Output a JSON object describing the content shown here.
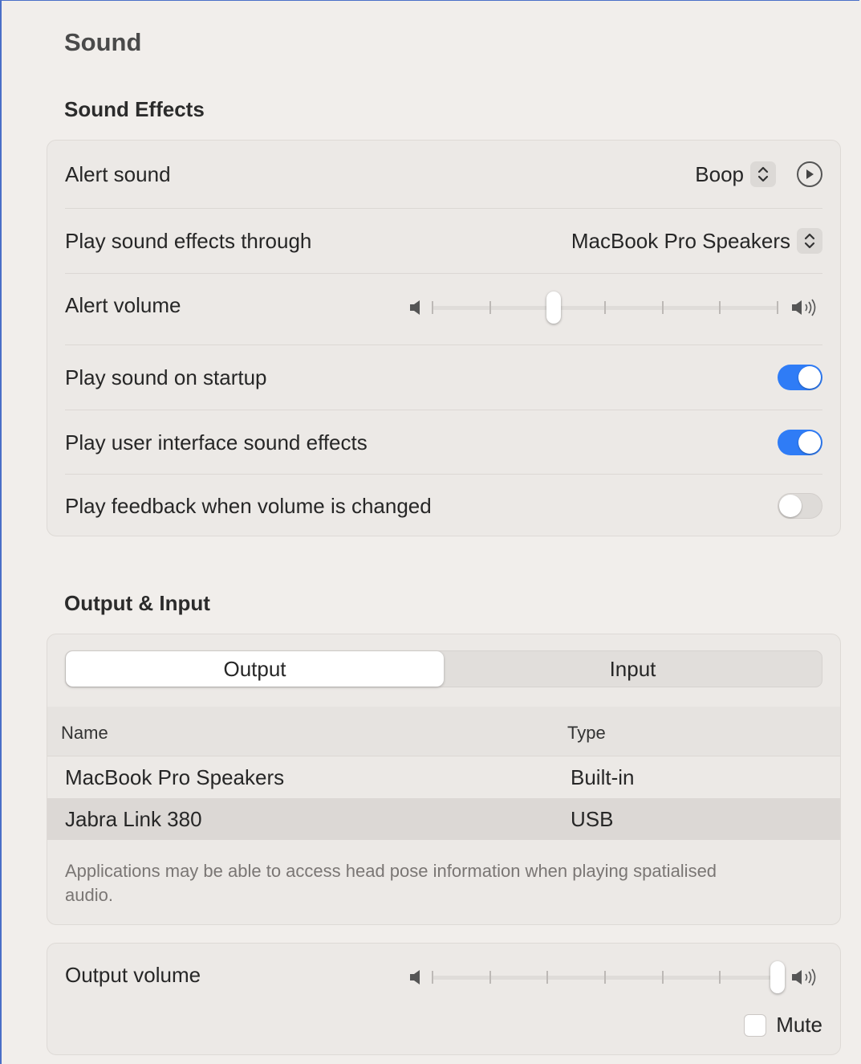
{
  "page": {
    "title": "Sound"
  },
  "sound_effects": {
    "title": "Sound Effects",
    "alert_sound": {
      "label": "Alert sound",
      "value": "Boop"
    },
    "play_through": {
      "label": "Play sound effects through",
      "value": "MacBook Pro Speakers"
    },
    "alert_volume": {
      "label": "Alert volume",
      "level": 0.35
    },
    "startup": {
      "label": "Play sound on startup",
      "on": true
    },
    "ui_effects": {
      "label": "Play user interface sound effects",
      "on": true
    },
    "feedback": {
      "label": "Play feedback when volume is changed",
      "on": false
    }
  },
  "output_input": {
    "title": "Output & Input",
    "tabs": [
      "Output",
      "Input"
    ],
    "selected_tab": "Output",
    "columns": {
      "name": "Name",
      "type": "Type"
    },
    "devices": [
      {
        "name": "MacBook Pro Speakers",
        "type": "Built-in",
        "selected": false
      },
      {
        "name": "Jabra Link 380",
        "type": "USB",
        "selected": true
      }
    ],
    "note": "Applications may be able to access head pose information when playing spatialised audio."
  },
  "output_volume": {
    "label": "Output volume",
    "level": 1.0,
    "mute_label": "Mute",
    "muted": false
  },
  "colors": {
    "accent": "#2f7cf6",
    "background": "#f1eeeb",
    "card": "#ece9e6"
  }
}
